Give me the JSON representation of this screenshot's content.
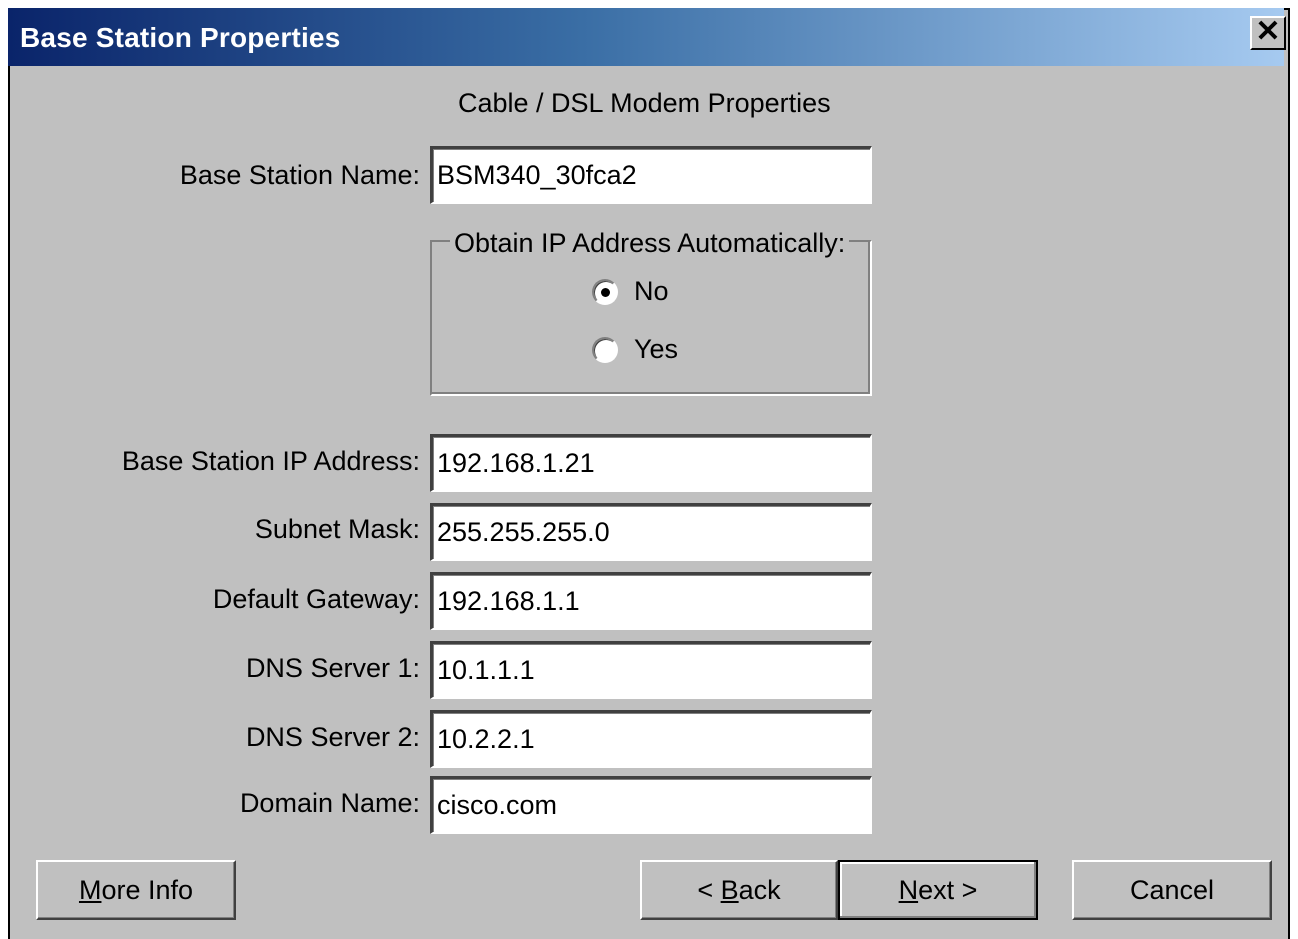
{
  "window": {
    "title": "Base Station Properties",
    "close_glyph": "✕"
  },
  "heading": "Cable / DSL Modem Properties",
  "fields": {
    "base_station_name": {
      "label": "Base Station Name:",
      "value": "BSM340_30fca2"
    },
    "ip_address": {
      "label": "Base Station IP Address:",
      "value": "192.168.1.21"
    },
    "subnet_mask": {
      "label": "Subnet Mask:",
      "value": "255.255.255.0"
    },
    "default_gateway": {
      "label": "Default Gateway:",
      "value": "192.168.1.1"
    },
    "dns_server_1": {
      "label": "DNS Server 1:",
      "value": "10.1.1.1"
    },
    "dns_server_2": {
      "label": "DNS Server 2:",
      "value": "10.2.2.1"
    },
    "domain_name": {
      "label": "Domain Name:",
      "value": "cisco.com"
    }
  },
  "obtain_ip": {
    "legend": "Obtain IP Address Automatically:",
    "options": [
      {
        "label": "No",
        "selected": true
      },
      {
        "label": "Yes",
        "selected": false
      }
    ]
  },
  "buttons": {
    "more_info": {
      "mnemonic": "M",
      "rest": "ore Info"
    },
    "back": {
      "prefix": "< ",
      "mnemonic": "B",
      "rest": "ack"
    },
    "next": {
      "mnemonic": "N",
      "rest": "ext >"
    },
    "cancel": {
      "label": "Cancel"
    }
  },
  "colors": {
    "face": "#c0c0c0",
    "title_start": "#0a246a",
    "title_end": "#a6caf0"
  }
}
